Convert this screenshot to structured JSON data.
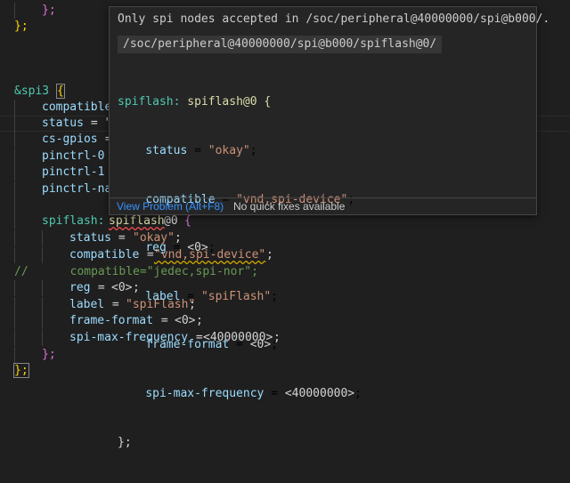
{
  "editor": {
    "lines": [
      {
        "indent": "    ",
        "closing": "};"
      },
      {
        "closing": "};"
      },
      {
        "blank": true
      },
      {
        "blank": true
      },
      {
        "ref": "&spi3",
        "open": "{"
      },
      {
        "prop": "compatible",
        "visible_rest": ""
      },
      {
        "prop": "status",
        "visible_rest": " = \""
      },
      {
        "prop": "cs-gpios",
        "visible_rest": " ="
      },
      {
        "prop": "pinctrl-0",
        "visible_rest": ""
      },
      {
        "prop": "pinctrl-1",
        "visible_rest": ""
      },
      {
        "prop": "pinctrl-na",
        "visible_rest": ""
      }
    ],
    "node_label": "spiflash:",
    "node_name": "spiflash",
    "node_unit": "@0",
    "node_open": "{",
    "props": [
      {
        "key": "status",
        "eq": " = ",
        "value": "\"okay\"",
        "end": ";"
      },
      {
        "key": "compatible",
        "eq": " = ",
        "value": "\"vnd,spi-device\"",
        "end": ";"
      },
      {
        "comment": "//      compatible=\"jedec,spi-nor\";"
      },
      {
        "key": "reg",
        "eq": " = ",
        "value": "<0>",
        "end": ";"
      },
      {
        "key": "label",
        "eq": " = ",
        "value": "\"spiFlash\"",
        "end": ";"
      },
      {
        "key": "frame-format",
        "eq": " = ",
        "value": "<0>",
        "end": ";"
      },
      {
        "key": "spi-max-frequency",
        "eq": " = ",
        "value": "<40000000>",
        "end": ";"
      }
    ],
    "node_close": "};",
    "outer_close": "};"
  },
  "hover": {
    "message": "Only spi nodes accepted in /soc/peripheral@40000000/spi@b000/.",
    "path": "/soc/peripheral@40000000/spi@b000/spiflash@0/",
    "code_header_label": "spiflash:",
    "code_header_node": "spiflash@0 {",
    "code_lines": [
      {
        "key": "status",
        "value": "\"okay\""
      },
      {
        "key": "compatible",
        "value": "\"vnd,spi-device\""
      },
      {
        "key": "reg",
        "value": "<0>"
      },
      {
        "key": "label",
        "value": "\"spiFlash\""
      },
      {
        "key": "frame-format",
        "value": "<0>"
      },
      {
        "key": "spi-max-frequency",
        "value": "<40000000>"
      }
    ],
    "code_close": "};",
    "view_problem": "View Problem (Alt+F8)",
    "no_fix": "No quick fixes available"
  },
  "colors": {
    "background": "#1f1f1f",
    "error_squiggle": "#f14c4c",
    "warning_squiggle": "#cca700",
    "link": "#3794ff"
  }
}
